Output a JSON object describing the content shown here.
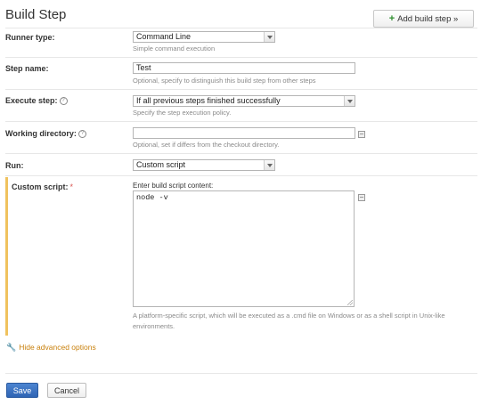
{
  "header": {
    "title": "Build Step",
    "add_button": "Add build step »"
  },
  "runner": {
    "label": "Runner type:",
    "value": "Command Line",
    "hint": "Simple command execution"
  },
  "step_name": {
    "label": "Step name:",
    "value": "Test",
    "hint": "Optional, specify to distinguish this build step from other steps"
  },
  "execute": {
    "label": "Execute step:",
    "value": "If all previous steps finished successfully",
    "hint": "Specify the step execution policy."
  },
  "workdir": {
    "label": "Working directory:",
    "value": "",
    "hint": "Optional, set if differs from the checkout directory."
  },
  "run": {
    "label": "Run:",
    "value": "Custom script"
  },
  "script": {
    "label": "Custom script:",
    "required_mark": "*",
    "prompt": "Enter build script content:",
    "value": "node -v",
    "hint_line1": "A platform-specific script, which will be executed as a .cmd file on Windows or as a shell script in Unix-like",
    "hint_line2": "environments."
  },
  "advanced": {
    "label": "Hide advanced options"
  },
  "actions": {
    "save": "Save",
    "cancel": "Cancel"
  }
}
